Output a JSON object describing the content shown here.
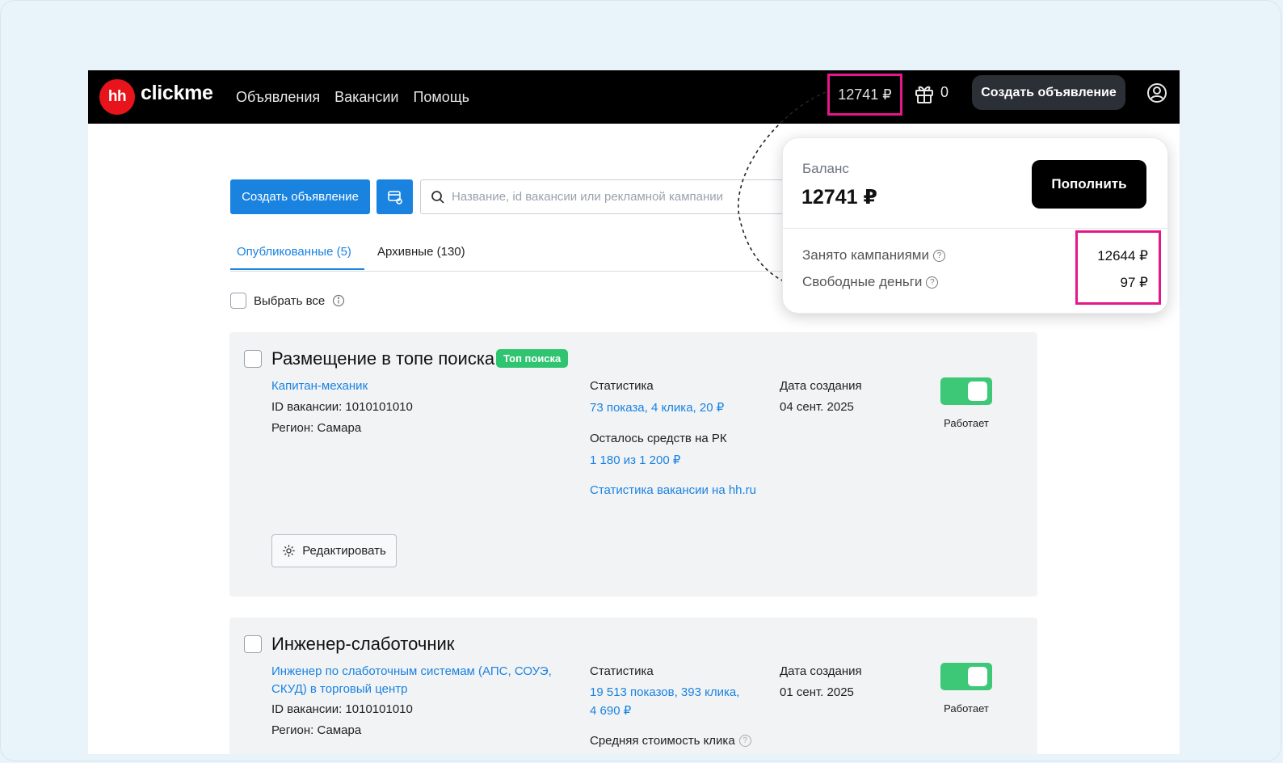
{
  "header": {
    "logo_badge": "hh",
    "logo_text": "clickme",
    "nav": [
      "Объявления",
      "Вакансии",
      "Помощь"
    ],
    "balance": "12741 ₽",
    "gift_count": "0",
    "create_button": "Создать объявление"
  },
  "toolbar": {
    "create_button": "Создать объявление",
    "search_placeholder": "Название, id вакансии или рекламной кампании"
  },
  "tabs": [
    {
      "label": "Опубликованные (5)",
      "active": true
    },
    {
      "label": "Архивные (130)",
      "active": false
    }
  ],
  "select_all_label": "Выбрать все",
  "cards": [
    {
      "title": "Размещение в топе поиска",
      "badge": "Топ поиска",
      "vacancy_link": "Капитан-механик",
      "vacancy_id": "ID вакансии: 1010101010",
      "region": "Регион: Самара",
      "stats_label": "Статистика",
      "stats_value": "73 показа, 4 клика, 20 ₽",
      "funds_label": "Осталось средств на РК",
      "funds_value": "1 180 из 1 200 ₽",
      "hh_stats_link": "Статистика вакансии на hh.ru",
      "date_label": "Дата создания",
      "date_value": "04 сент. 2025",
      "status": "Работает",
      "edit_button": "Редактировать"
    },
    {
      "title": "Инженер-слаботочник",
      "vacancy_link_line1": "Инженер по слаботочным системам (АПС, СОУЭ,",
      "vacancy_link_line2": "СКУД) в торговый центр",
      "vacancy_id": "ID вакансии: 1010101010",
      "region": "Регион: Самара",
      "stats_label": "Статистика",
      "stats_value_line1": "19 513 показов, 393 клика,",
      "stats_value_line2": "4 690 ₽",
      "avg_click_label": "Средняя стоимость клика",
      "date_label": "Дата создания",
      "date_value": "01 сент. 2025",
      "status": "Работает"
    }
  ],
  "balance_popup": {
    "label": "Баланс",
    "amount": "12741 ₽",
    "topup_button": "Пополнить",
    "busy_label": "Занято кампаниями",
    "busy_value": "12644 ₽",
    "free_label": "Свободные деньги",
    "free_value": "97 ₽"
  },
  "colors": {
    "accent": "#1a83e0",
    "highlight": "#e5178a",
    "toggle_on": "#3dc878",
    "badge": "#2fc46f",
    "logo": "#e8141c"
  }
}
